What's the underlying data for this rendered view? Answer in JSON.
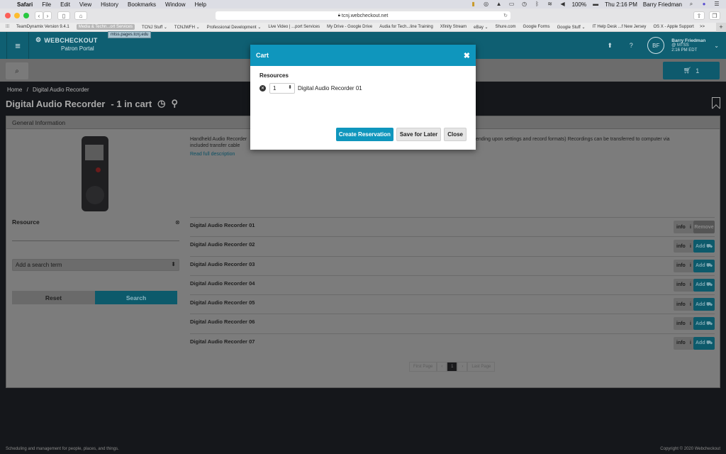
{
  "menubar": {
    "app": "Safari",
    "items": [
      "File",
      "Edit",
      "View",
      "History",
      "Bookmarks",
      "Window",
      "Help"
    ],
    "battery": "100%",
    "clock": "Thu 2:16 PM",
    "user": "Barry Friedman"
  },
  "browser": {
    "url": "tcnj.webcheckout.net",
    "bookmarks": [
      "TeamDynamix Version 9.4.1",
      "Media & Techn...ort Services",
      "TCNJ Stuff ⌄",
      "TCNJWFH ⌄",
      "Professional Development ⌄",
      "Live Video | ...port Services",
      "My Drive - Google Drive",
      "Audia for Tech...line Training",
      "Xfinity Stream",
      "eBay ⌄",
      "Shure.com",
      "Google Forms",
      "Google Stuff ⌄",
      "IT Help Desk ...f New Jersey",
      "OS X - Apple Support",
      ">>"
    ],
    "tooltip": "mtss.pages.tcnj.edu"
  },
  "header": {
    "brand": "WEBCHECKOUT",
    "portal": "Patron Portal",
    "avatar_initials": "BF",
    "user_name": "Barry Friedman",
    "user_org": "@ MTSS",
    "user_time": "2:16 PM EDT"
  },
  "cart": {
    "count": "1"
  },
  "breadcrumb": {
    "home": "Home",
    "sep": "/",
    "current": "Digital Audio Recorder"
  },
  "page": {
    "title": "Digital Audio Recorder",
    "cart_status": "-  1 in cart",
    "panel_title": "General Information",
    "description_1": "Handheld Audio Recorder",
    "description_2": "(depending upon settings and record formats)  Recordings can be transferred to computer via",
    "description_3": "included transfer cable",
    "read_more": "Read full description"
  },
  "search": {
    "resource_label": "Resource",
    "term_placeholder": "Add a search term",
    "reset": "Reset",
    "submit": "Search"
  },
  "resources": [
    {
      "name": "Digital Audio Recorder 01",
      "info": "info",
      "action": "Remove"
    },
    {
      "name": "Digital Audio Recorder 02",
      "info": "info",
      "action": "Add"
    },
    {
      "name": "Digital Audio Recorder 03",
      "info": "info",
      "action": "Add"
    },
    {
      "name": "Digital Audio Recorder 04",
      "info": "info",
      "action": "Add"
    },
    {
      "name": "Digital Audio Recorder 05",
      "info": "info",
      "action": "Add"
    },
    {
      "name": "Digital Audio Recorder 06",
      "info": "info",
      "action": "Add"
    },
    {
      "name": "Digital Audio Recorder 07",
      "info": "info",
      "action": "Add"
    }
  ],
  "pager": {
    "first": "First Page",
    "prev": "‹",
    "current": "1",
    "next": "›",
    "last": "Last Page"
  },
  "footer": {
    "tagline": "Scheduling and management for people, places, and things.",
    "copyright": "Copyright © 2020 Webcheckout"
  },
  "dialog": {
    "title": "Cart",
    "section": "Resources",
    "item_qty": "1",
    "item_name": "Digital Audio Recorder 01",
    "create": "Create Reservation",
    "save": "Save for Later",
    "close": "Close"
  },
  "colors": {
    "brand": "#0f5f72",
    "accent": "#0f96bd"
  }
}
